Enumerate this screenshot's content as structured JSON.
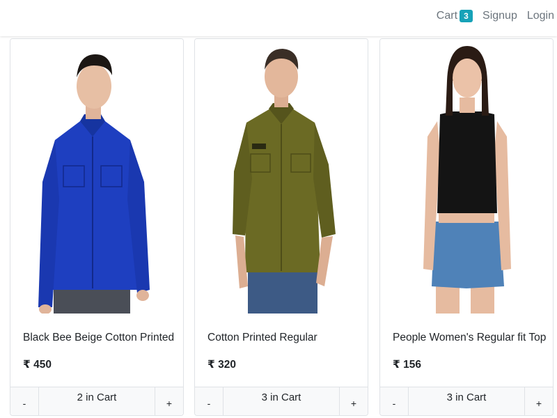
{
  "nav": {
    "cart_label": "Cart",
    "cart_count": "3",
    "signup_label": "Signup",
    "login_label": "Login",
    "badge_color": "#17a2b8"
  },
  "products": [
    {
      "title": "Black Bee Beige Cotton Printed",
      "price": "₹ 450",
      "minus_label": "-",
      "cart_qty_label": "2 in Cart",
      "plus_label": "+",
      "image": "man-blue-shirt",
      "garment_color": "#1e3fc0"
    },
    {
      "title": "Cotton Printed Regular",
      "price": "₹ 320",
      "minus_label": "-",
      "cart_qty_label": "3 in Cart",
      "plus_label": "+",
      "image": "man-olive-shirt",
      "garment_color": "#6b6a24"
    },
    {
      "title": "People Women's Regular fit Top",
      "price": "₹ 156",
      "minus_label": "-",
      "cart_qty_label": "3 in Cart",
      "plus_label": "+",
      "image": "woman-black-top",
      "garment_color": "#141414"
    }
  ]
}
